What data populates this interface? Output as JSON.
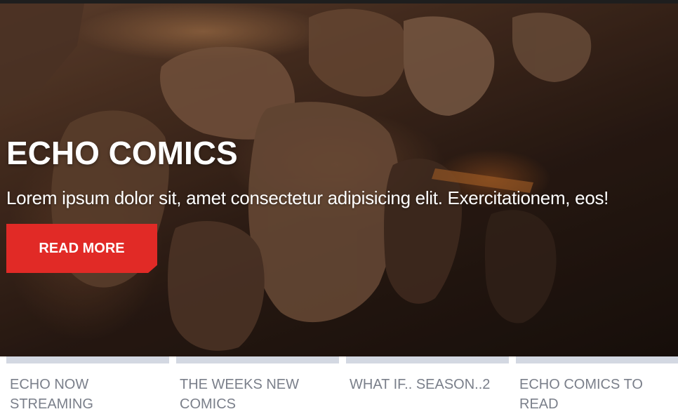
{
  "hero": {
    "title": "ECHO COMICS",
    "subtitle": "Lorem ipsum dolor sit, amet consectetur adipisicing elit. Exercitationem, eos!",
    "cta_label": "READ MORE",
    "cta_color": "#e12a26",
    "background": "aerial photo of desert rock formations"
  },
  "cards": [
    {
      "label": "ECHO NOW STREAMING"
    },
    {
      "label": "THE WEEKS NEW COMICS"
    },
    {
      "label": "WHAT IF.. SEASON..2"
    },
    {
      "label": "ECHO COMICS TO READ"
    }
  ]
}
